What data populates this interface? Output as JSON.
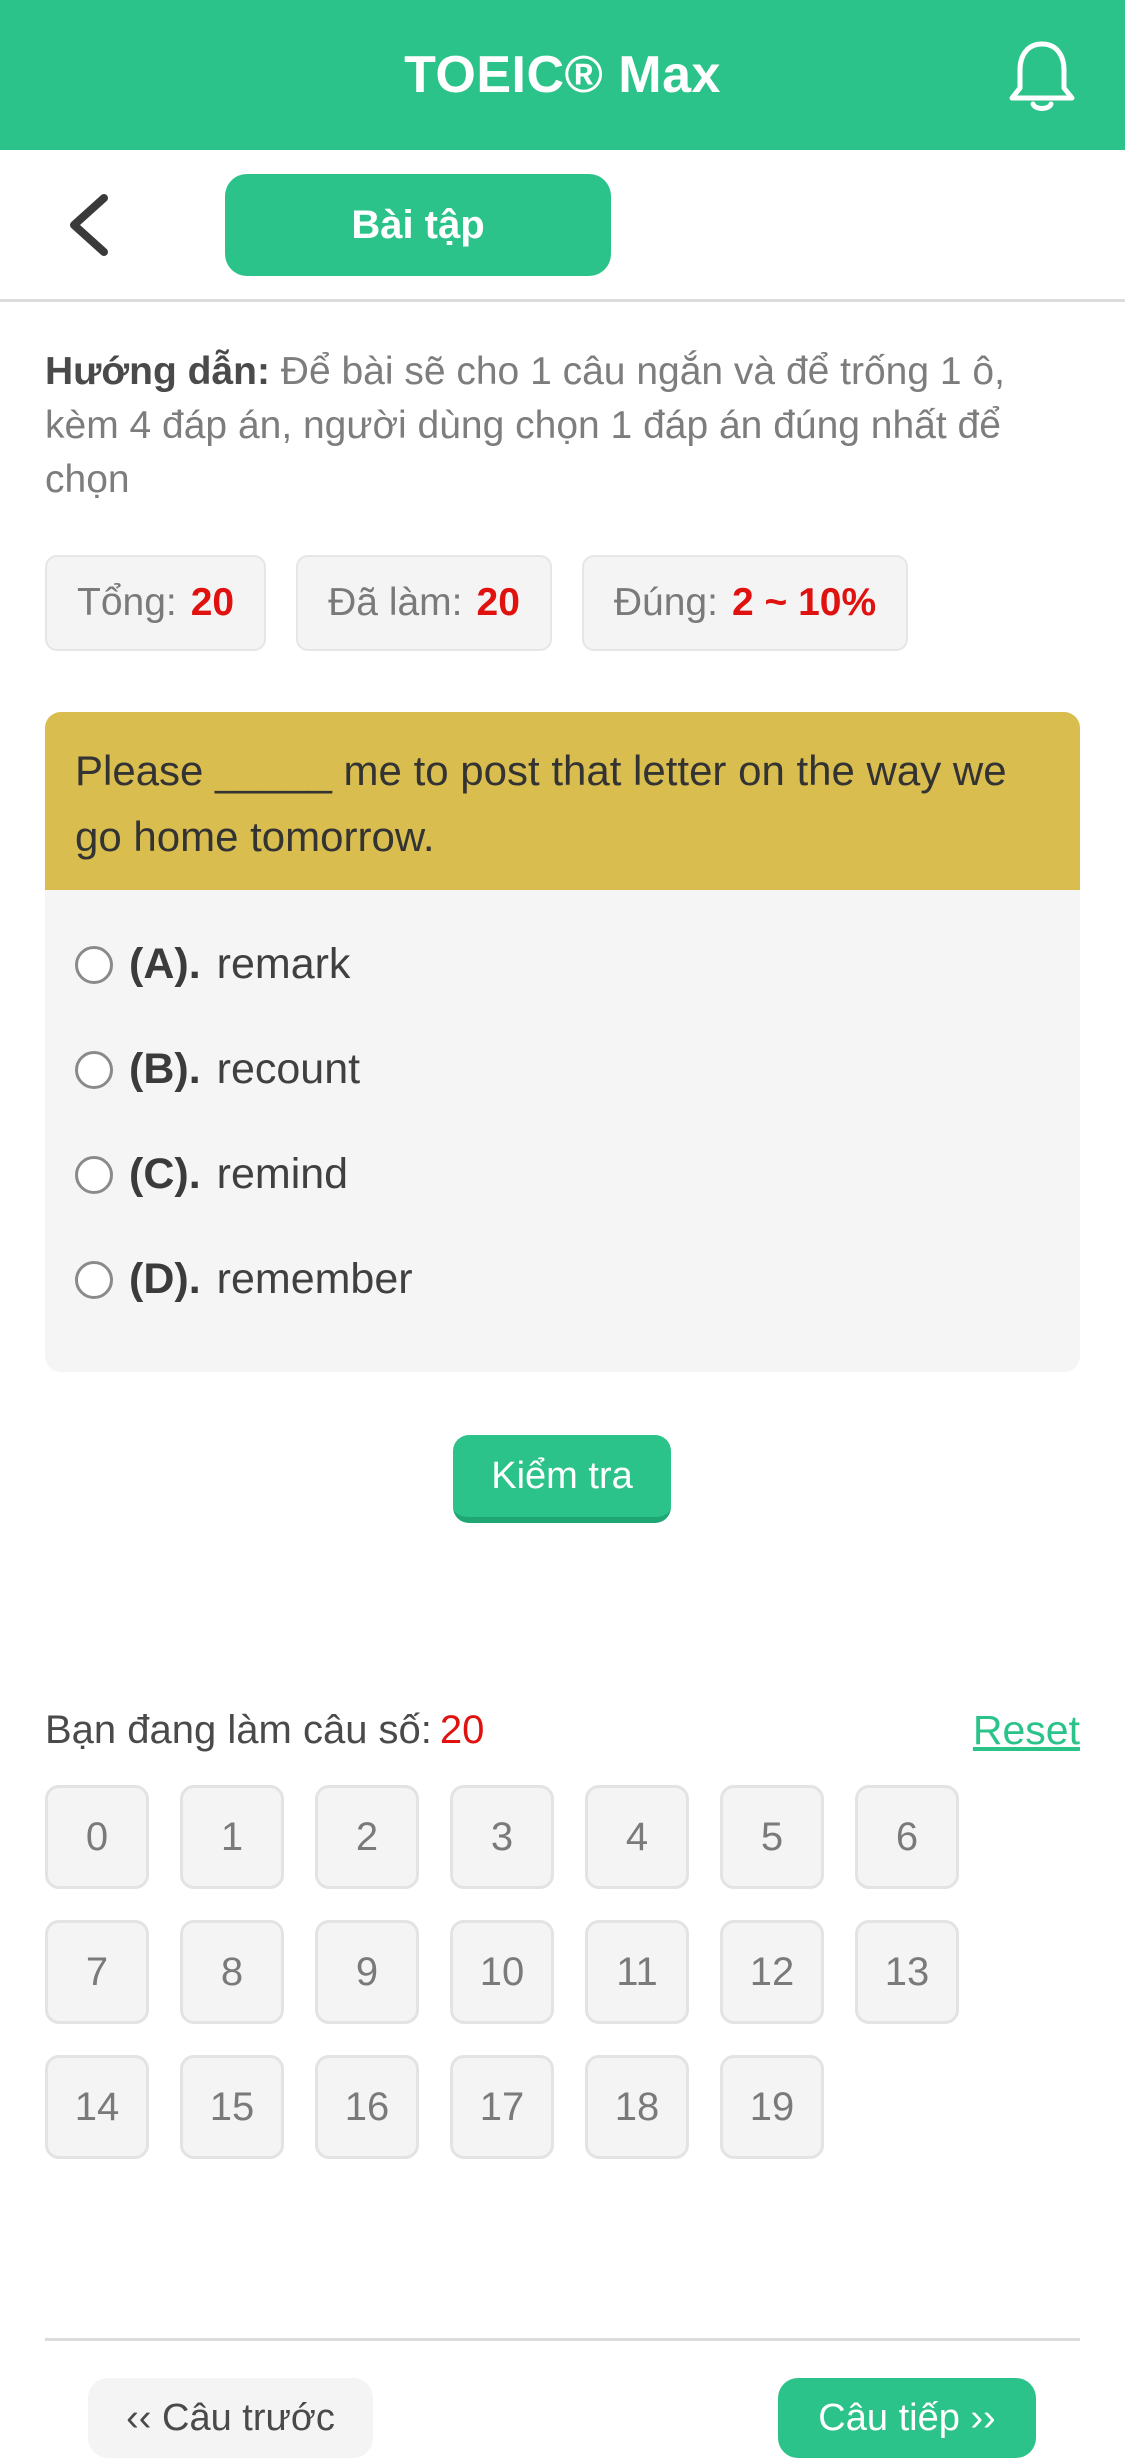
{
  "header": {
    "title": "TOEIC® Max",
    "bell_icon": "bell-icon"
  },
  "subbar": {
    "back_icon": "chevron-left-icon",
    "tab_label": "Bài tập"
  },
  "guide": {
    "label": "Hướng dẫn:",
    "text": " Để bài sẽ cho 1 câu ngắn và để trống 1 ô, kèm 4 đáp án, người dùng chọn 1 đáp án đúng nhất để chọn"
  },
  "stats": [
    {
      "label": "Tổng:",
      "value": "20"
    },
    {
      "label": "Đã làm:",
      "value": "20"
    },
    {
      "label": "Đúng:",
      "value": "2 ~ 10%"
    }
  ],
  "question": {
    "text": "Please _____ me to post that letter on the way we go home tomorrow.",
    "options": [
      {
        "letter": "(A).",
        "text": "remark"
      },
      {
        "letter": "(B).",
        "text": "recount"
      },
      {
        "letter": "(C).",
        "text": "remind"
      },
      {
        "letter": "(D).",
        "text": "remember"
      }
    ]
  },
  "check_button": "Kiểm tra",
  "progress": {
    "label": "Bạn đang làm câu số:",
    "current": "20",
    "reset": "Reset"
  },
  "question_numbers": [
    "0",
    "1",
    "2",
    "3",
    "4",
    "5",
    "6",
    "7",
    "8",
    "9",
    "10",
    "11",
    "12",
    "13",
    "14",
    "15",
    "16",
    "17",
    "18",
    "19"
  ],
  "nav": {
    "prev": "‹‹ Câu trước",
    "next": "Câu tiếp ››"
  },
  "colors": {
    "accent": "#2cc38a",
    "question_bg": "#d9bd4f",
    "highlight": "#e0120f"
  }
}
